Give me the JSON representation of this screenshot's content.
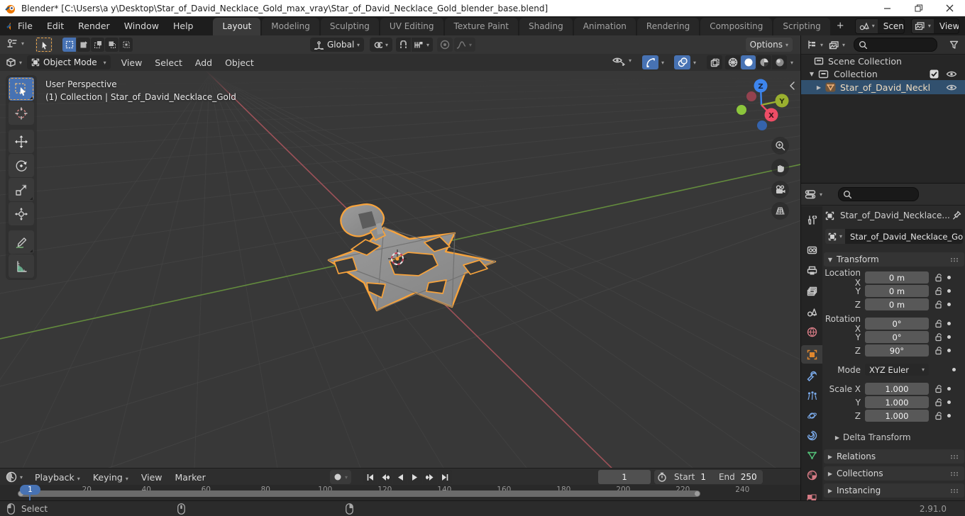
{
  "window": {
    "title": "Blender* [C:\\Users\\a y\\Desktop\\Star_of_David_Necklace_Gold_max_vray\\Star_of_David_Necklace_Gold_blender_base.blend]"
  },
  "topbar": {
    "menus": [
      "File",
      "Edit",
      "Render",
      "Window",
      "Help"
    ],
    "tabs": [
      "Layout",
      "Modeling",
      "Sculpting",
      "UV Editing",
      "Texture Paint",
      "Shading",
      "Animation",
      "Rendering",
      "Compositing",
      "Scripting"
    ],
    "active_tab": "Layout",
    "new_tab_label": "+",
    "scene_selector": {
      "value": "Scene"
    },
    "view_layer_selector": {
      "value": "View Layer"
    }
  },
  "tool_settings": {
    "orientation": "Global",
    "options": "Options"
  },
  "viewport": {
    "header": {
      "mode": "Object Mode",
      "menus": [
        "View",
        "Select",
        "Add",
        "Object"
      ]
    },
    "overlay": {
      "line1": "User Perspective",
      "line2": "(1) Collection | Star_of_David_Necklace_Gold"
    },
    "gizmo_axes": {
      "x": "X",
      "y": "Y",
      "z": "Z"
    }
  },
  "outliner": {
    "rows": [
      {
        "label": "Scene Collection"
      },
      {
        "label": "Collection"
      },
      {
        "label": "Star_of_David_Neckl"
      }
    ]
  },
  "properties": {
    "breadcrumb": "Star_of_David_Necklace...",
    "object_name": "Star_of_David_Necklace_Gold",
    "transform_title": "Transform",
    "rows": [
      {
        "label": "Location X",
        "value": "0 m"
      },
      {
        "label": "Y",
        "value": "0 m"
      },
      {
        "label": "Z",
        "value": "0 m"
      },
      {
        "label": "Rotation X",
        "value": "0°"
      },
      {
        "label": "Y",
        "value": "0°"
      },
      {
        "label": "Z",
        "value": "90°"
      },
      {
        "label": "Scale X",
        "value": "1.000"
      },
      {
        "label": "Y",
        "value": "1.000"
      },
      {
        "label": "Z",
        "value": "1.000"
      }
    ],
    "mode_row": {
      "label": "Mode",
      "value": "XYZ Euler"
    },
    "sub_panels": [
      "Delta Transform"
    ],
    "panels": [
      "Relations",
      "Collections",
      "Instancing"
    ]
  },
  "timeline": {
    "menus": [
      "Playback",
      "Keying",
      "View",
      "Marker"
    ],
    "current_frame": "1",
    "start_label": "Start",
    "start_value": "1",
    "end_label": "End",
    "end_value": "250",
    "ruler_marks": [
      20,
      40,
      60,
      80,
      100,
      120,
      140,
      160,
      180,
      200,
      220,
      240
    ]
  },
  "status_bar": {
    "left_label": "Select",
    "version": "2.91.0"
  },
  "colors": {
    "accent_blue": "#4772b3",
    "selection_orange": "#f7a33c",
    "axis_red": "#a8545c",
    "axis_green": "#6b9a3f"
  }
}
